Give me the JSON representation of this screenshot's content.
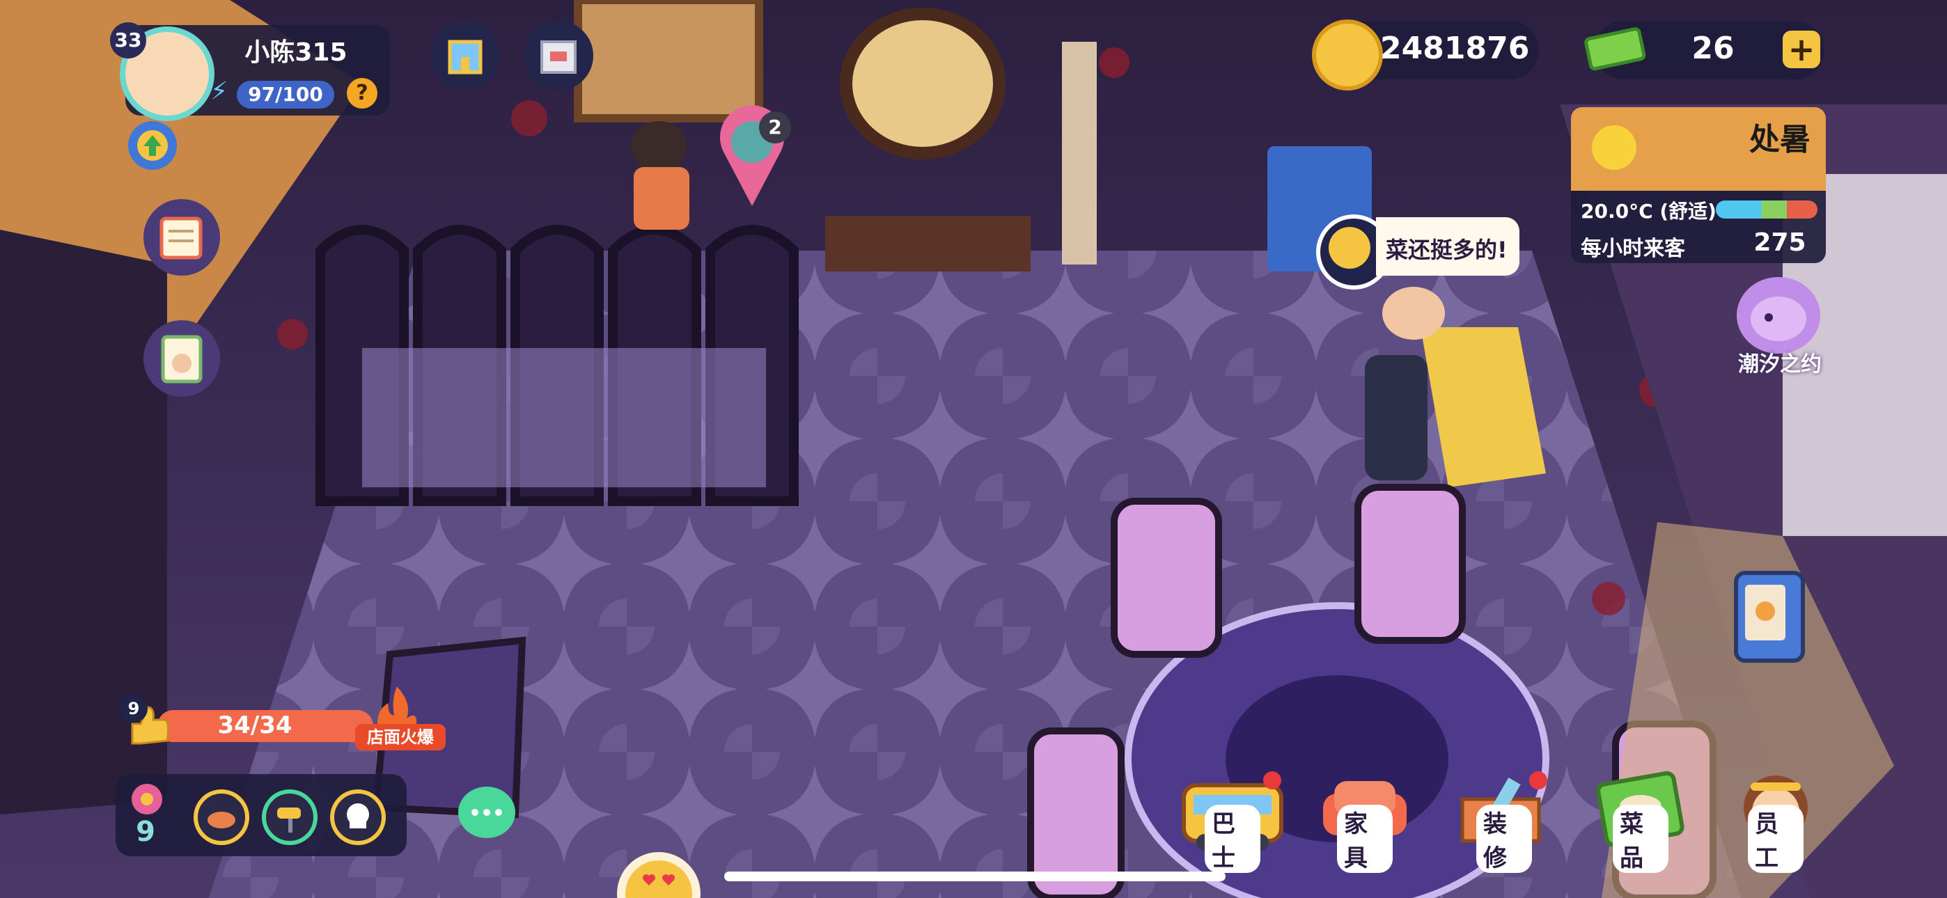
{
  "player": {
    "level": "33",
    "name": "小陈315",
    "energy": "97/100",
    "help": "?"
  },
  "currency": {
    "coins": "2481876",
    "cash": "26",
    "add": "+"
  },
  "weather": {
    "season": "处暑",
    "temperature": "20.0°C (舒适)",
    "visitors_label": "每小时来客",
    "visitors_value": "275"
  },
  "event": {
    "label": "潮汐之约"
  },
  "notifications": {
    "map_pin_count": "2"
  },
  "speech": {
    "text": "菜还挺多的!"
  },
  "popularity": {
    "level": "9",
    "progress_text": "34/34",
    "progress_fraction": 1.0,
    "status": "店面火爆"
  },
  "bottom_left": {
    "flower_count": "9"
  },
  "menu": [
    {
      "label": "巴士",
      "icon": "bus-icon"
    },
    {
      "label": "家具",
      "icon": "armchair-icon"
    },
    {
      "label": "装修",
      "icon": "renovation-icon"
    },
    {
      "label": "菜品",
      "icon": "recipe-book-icon"
    },
    {
      "label": "员工",
      "icon": "staff-icon"
    }
  ],
  "colors": {
    "floor": "#5a4a7e",
    "wall": "#3a2d55",
    "gold": "#f5c542",
    "progress": "#f26a4b",
    "panel": "#1f1d3c"
  }
}
